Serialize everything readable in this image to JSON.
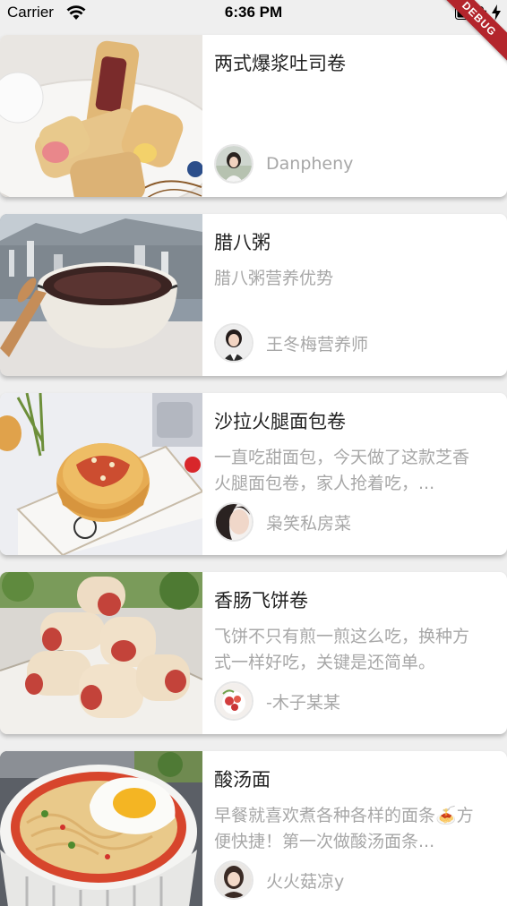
{
  "status_bar": {
    "carrier": "Carrier",
    "time": "6:36 PM",
    "wifi_icon": "wifi-icon",
    "battery_icon": "battery-icon"
  },
  "debug_banner": "DEBUG",
  "recipes": [
    {
      "title": "两式爆浆吐司卷",
      "desc": "",
      "author": "Danpheny"
    },
    {
      "title": "腊八粥",
      "desc": "腊八粥营养优势",
      "author": "王冬梅营养师"
    },
    {
      "title": "沙拉火腿面包卷",
      "desc": "一直吃甜面包，今天做了这款芝香火腿面包卷，家人抢着吃，...",
      "author": "枭笑私房菜"
    },
    {
      "title": "香肠飞饼卷",
      "desc": "飞饼不只有煎一煎这么吃，换种方式一样好吃，关键是还简单。",
      "author": "-木子某某"
    },
    {
      "title": "酸汤面",
      "desc": "早餐就喜欢煮各种各样的面条🍝方便快捷！第一次做酸汤面条...",
      "author": "火火菇凉y"
    }
  ],
  "colors": {
    "background": "#efefef",
    "card": "#ffffff",
    "title_text": "#222222",
    "secondary_text": "#a7a7a7",
    "debug_banner": "#b3252c"
  }
}
